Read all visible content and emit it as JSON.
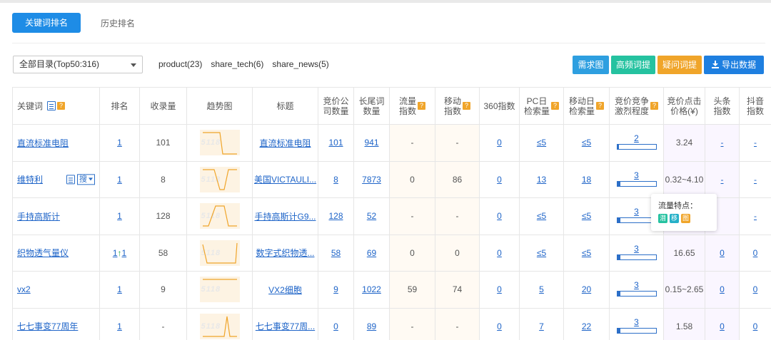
{
  "tabs": [
    {
      "label": "关键词排名",
      "active": true
    },
    {
      "label": "历史排名",
      "active": false
    }
  ],
  "filter": {
    "select_value": "全部目录(Top50:316)",
    "categories": [
      "product(23)",
      "share_tech(6)",
      "share_news(5)"
    ]
  },
  "toolbar": {
    "demand_map": "需求图谱",
    "high_freq": "高频词提取",
    "question_words": "疑问词提取",
    "export": "导出数据"
  },
  "columns": [
    {
      "label": "关键词"
    },
    {
      "label": "排名"
    },
    {
      "label": "收录量"
    },
    {
      "label": "趋势图"
    },
    {
      "label": "标题"
    },
    {
      "label": "竞价公\n司数量"
    },
    {
      "label": "长尾词\n数量"
    },
    {
      "label": "流量\n指数"
    },
    {
      "label": "移动\n指数"
    },
    {
      "label": "360指数"
    },
    {
      "label": "PC日\n检索量"
    },
    {
      "label": "移动日\n检索量"
    },
    {
      "label": "竞价竞争\n激烈程度"
    },
    {
      "label": "竞价点击\n价格(¥)"
    },
    {
      "label": "头条\n指数"
    },
    {
      "label": "抖音\n指数"
    }
  ],
  "rows": [
    {
      "keyword": "直流标准电阻",
      "rank": "1",
      "rank_up": "",
      "indexed": "101",
      "title": "直流标准电阻",
      "bid_companies": "101",
      "long_tail": "941",
      "traffic": "-",
      "mobile": "-",
      "idx360": "0",
      "pc_daily": "≤5",
      "mobile_daily": "≤5",
      "compete": "2",
      "compete_level": 0.05,
      "price": "3.24",
      "toutiao": "-",
      "douyin": "-"
    },
    {
      "keyword": "维特利",
      "rank": "1",
      "rank_up": "",
      "indexed": "8",
      "title": "美国VICTAULI...",
      "bid_companies": "8",
      "long_tail": "7873",
      "traffic": "0",
      "mobile": "86",
      "idx360": "0",
      "pc_daily": "13",
      "mobile_daily": "18",
      "compete": "3",
      "compete_level": 0.08,
      "price": "0.32~4.10",
      "toutiao": "-",
      "douyin": "-",
      "search_label": "搜"
    },
    {
      "keyword": "手持高斯计",
      "rank": "1",
      "rank_up": "",
      "indexed": "128",
      "title": "手持高斯计G9...",
      "bid_companies": "128",
      "long_tail": "52",
      "traffic": "-",
      "mobile": "-",
      "idx360": "0",
      "pc_daily": "≤5",
      "mobile_daily": "≤5",
      "compete": "3",
      "compete_level": 0.08,
      "price": "",
      "toutiao": "",
      "douyin": "-"
    },
    {
      "keyword": "织物透气量仪",
      "rank": "1",
      "rank_up": "1",
      "indexed": "58",
      "title": "数字式织物透...",
      "bid_companies": "58",
      "long_tail": "69",
      "traffic": "0",
      "mobile": "0",
      "idx360": "0",
      "pc_daily": "≤5",
      "mobile_daily": "≤5",
      "compete": "3",
      "compete_level": 0.08,
      "price": "16.65",
      "toutiao": "0",
      "douyin": "0"
    },
    {
      "keyword": "vx2",
      "rank": "1",
      "rank_up": "",
      "indexed": "9",
      "title": "VX2细胞",
      "bid_companies": "9",
      "long_tail": "1022",
      "traffic": "59",
      "mobile": "74",
      "idx360": "0",
      "pc_daily": "5",
      "mobile_daily": "20",
      "compete": "3",
      "compete_level": 0.08,
      "price": "0.15~2.65",
      "toutiao": "0",
      "douyin": "0"
    },
    {
      "keyword": "七七事变77周年",
      "rank": "1",
      "rank_up": "",
      "indexed": "-",
      "title": "七七事变77周...",
      "bid_companies": "0",
      "long_tail": "89",
      "traffic": "-",
      "mobile": "-",
      "idx360": "0",
      "pc_daily": "7",
      "mobile_daily": "22",
      "compete": "3",
      "compete_level": 0.08,
      "price": "1.58",
      "toutiao": "0",
      "douyin": "0"
    }
  ],
  "tooltip": {
    "title": "流量特点：",
    "tags": [
      "潜",
      "移",
      "图"
    ],
    "tag_colors": [
      "#25c2a0",
      "#25b0c8",
      "#f0a52a"
    ]
  },
  "colors": {
    "primary": "#1e8ce6",
    "link": "#1e64c8",
    "help_badge": "#f0a52a"
  }
}
